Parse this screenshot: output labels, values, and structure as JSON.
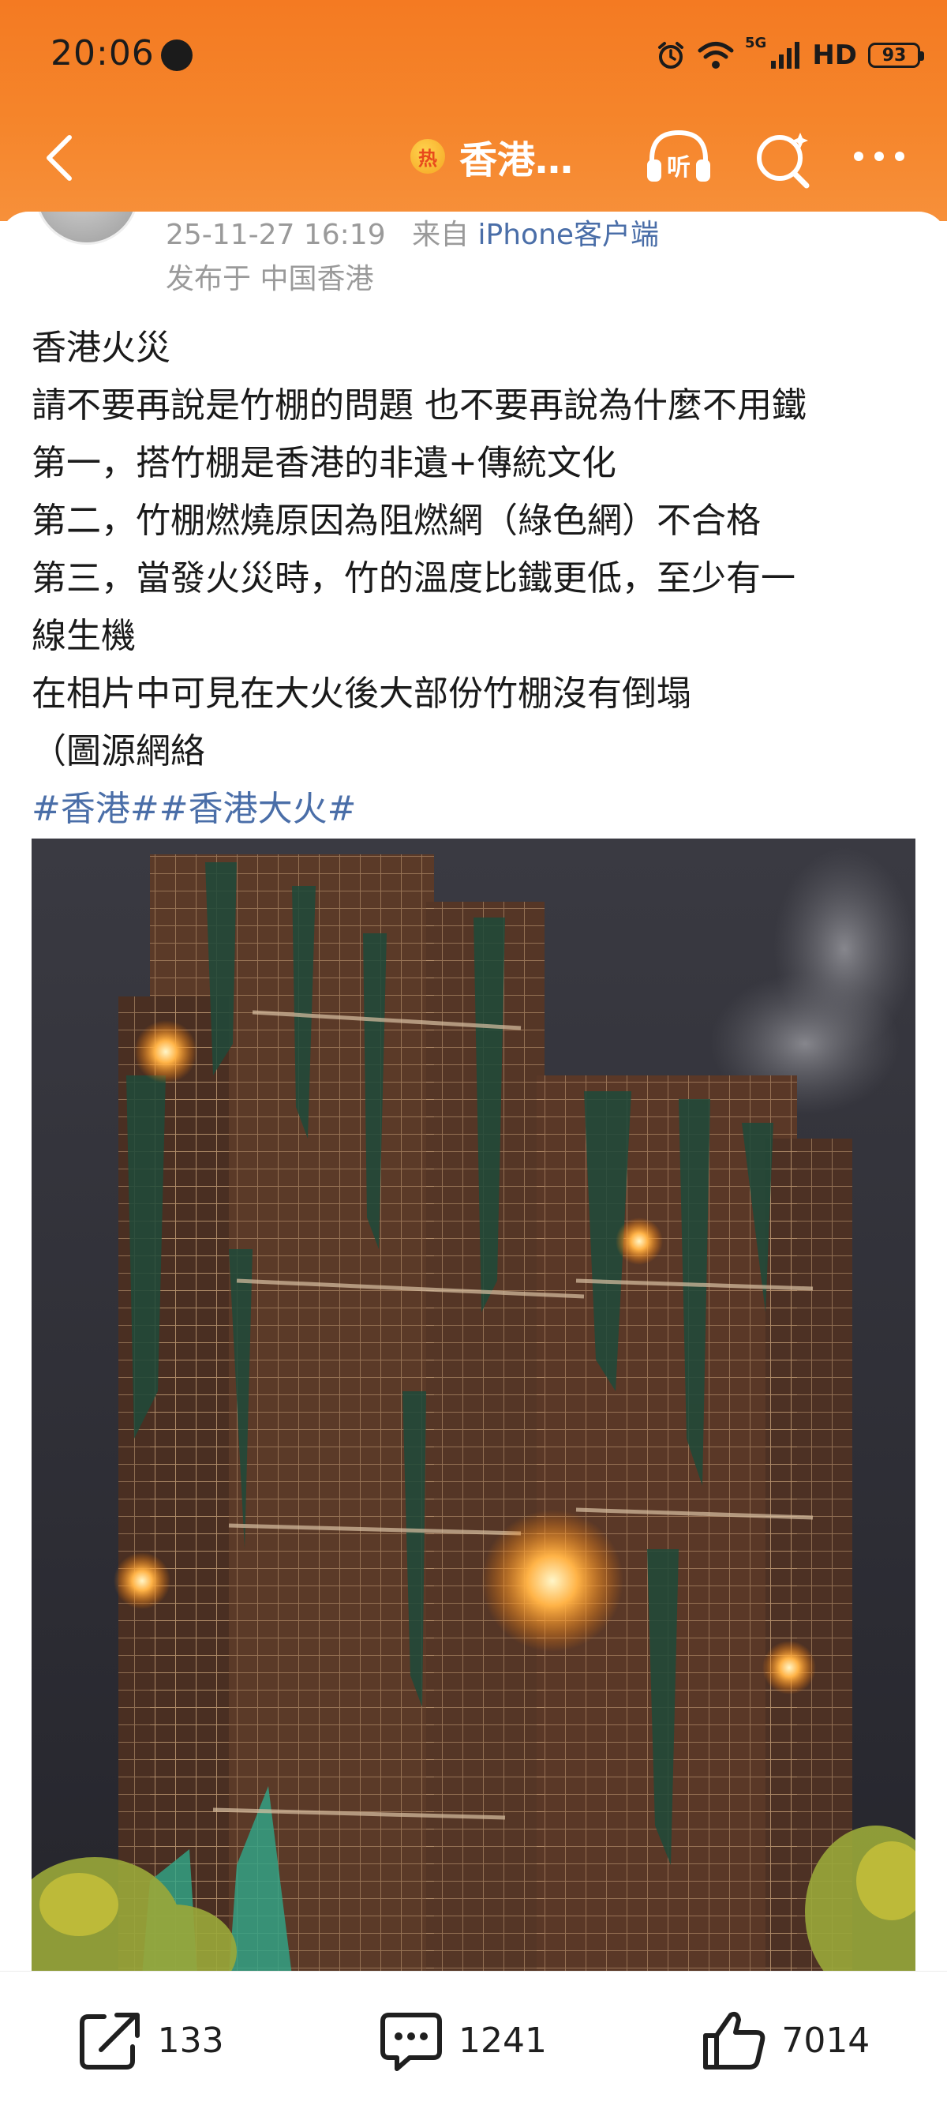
{
  "status_bar": {
    "time": "20:06",
    "network": "5G",
    "hd_label": "HD",
    "battery": "93"
  },
  "nav": {
    "hot_badge": "热",
    "topic_title": "香港…"
  },
  "post": {
    "timestamp": "25-11-27 16:19",
    "from_label": "来自",
    "client": "iPhone客户端",
    "location": "发布于 中国香港",
    "lines": [
      "香港火災",
      "請不要再說是竹棚的問題 也不要再說為什麼不用鐵",
      "第一，搭竹棚是香港的非遺+傳統文化",
      "第二，竹棚燃燒原因為阻燃網（綠色網）不合格",
      "第三，當發火災時，竹的溫度比鐵更低，至少有一",
      "線生機",
      "在相片中可見在大火後大部份竹棚沒有倒塌",
      "（圖源網絡"
    ],
    "hashtags": "#香港##香港大火#"
  },
  "actions": {
    "repost_count": "133",
    "comment_count": "1241",
    "like_count": "7014"
  },
  "colors": {
    "header": "#f47a22",
    "link": "#4a6ea8",
    "meta": "#9a9a9a"
  }
}
